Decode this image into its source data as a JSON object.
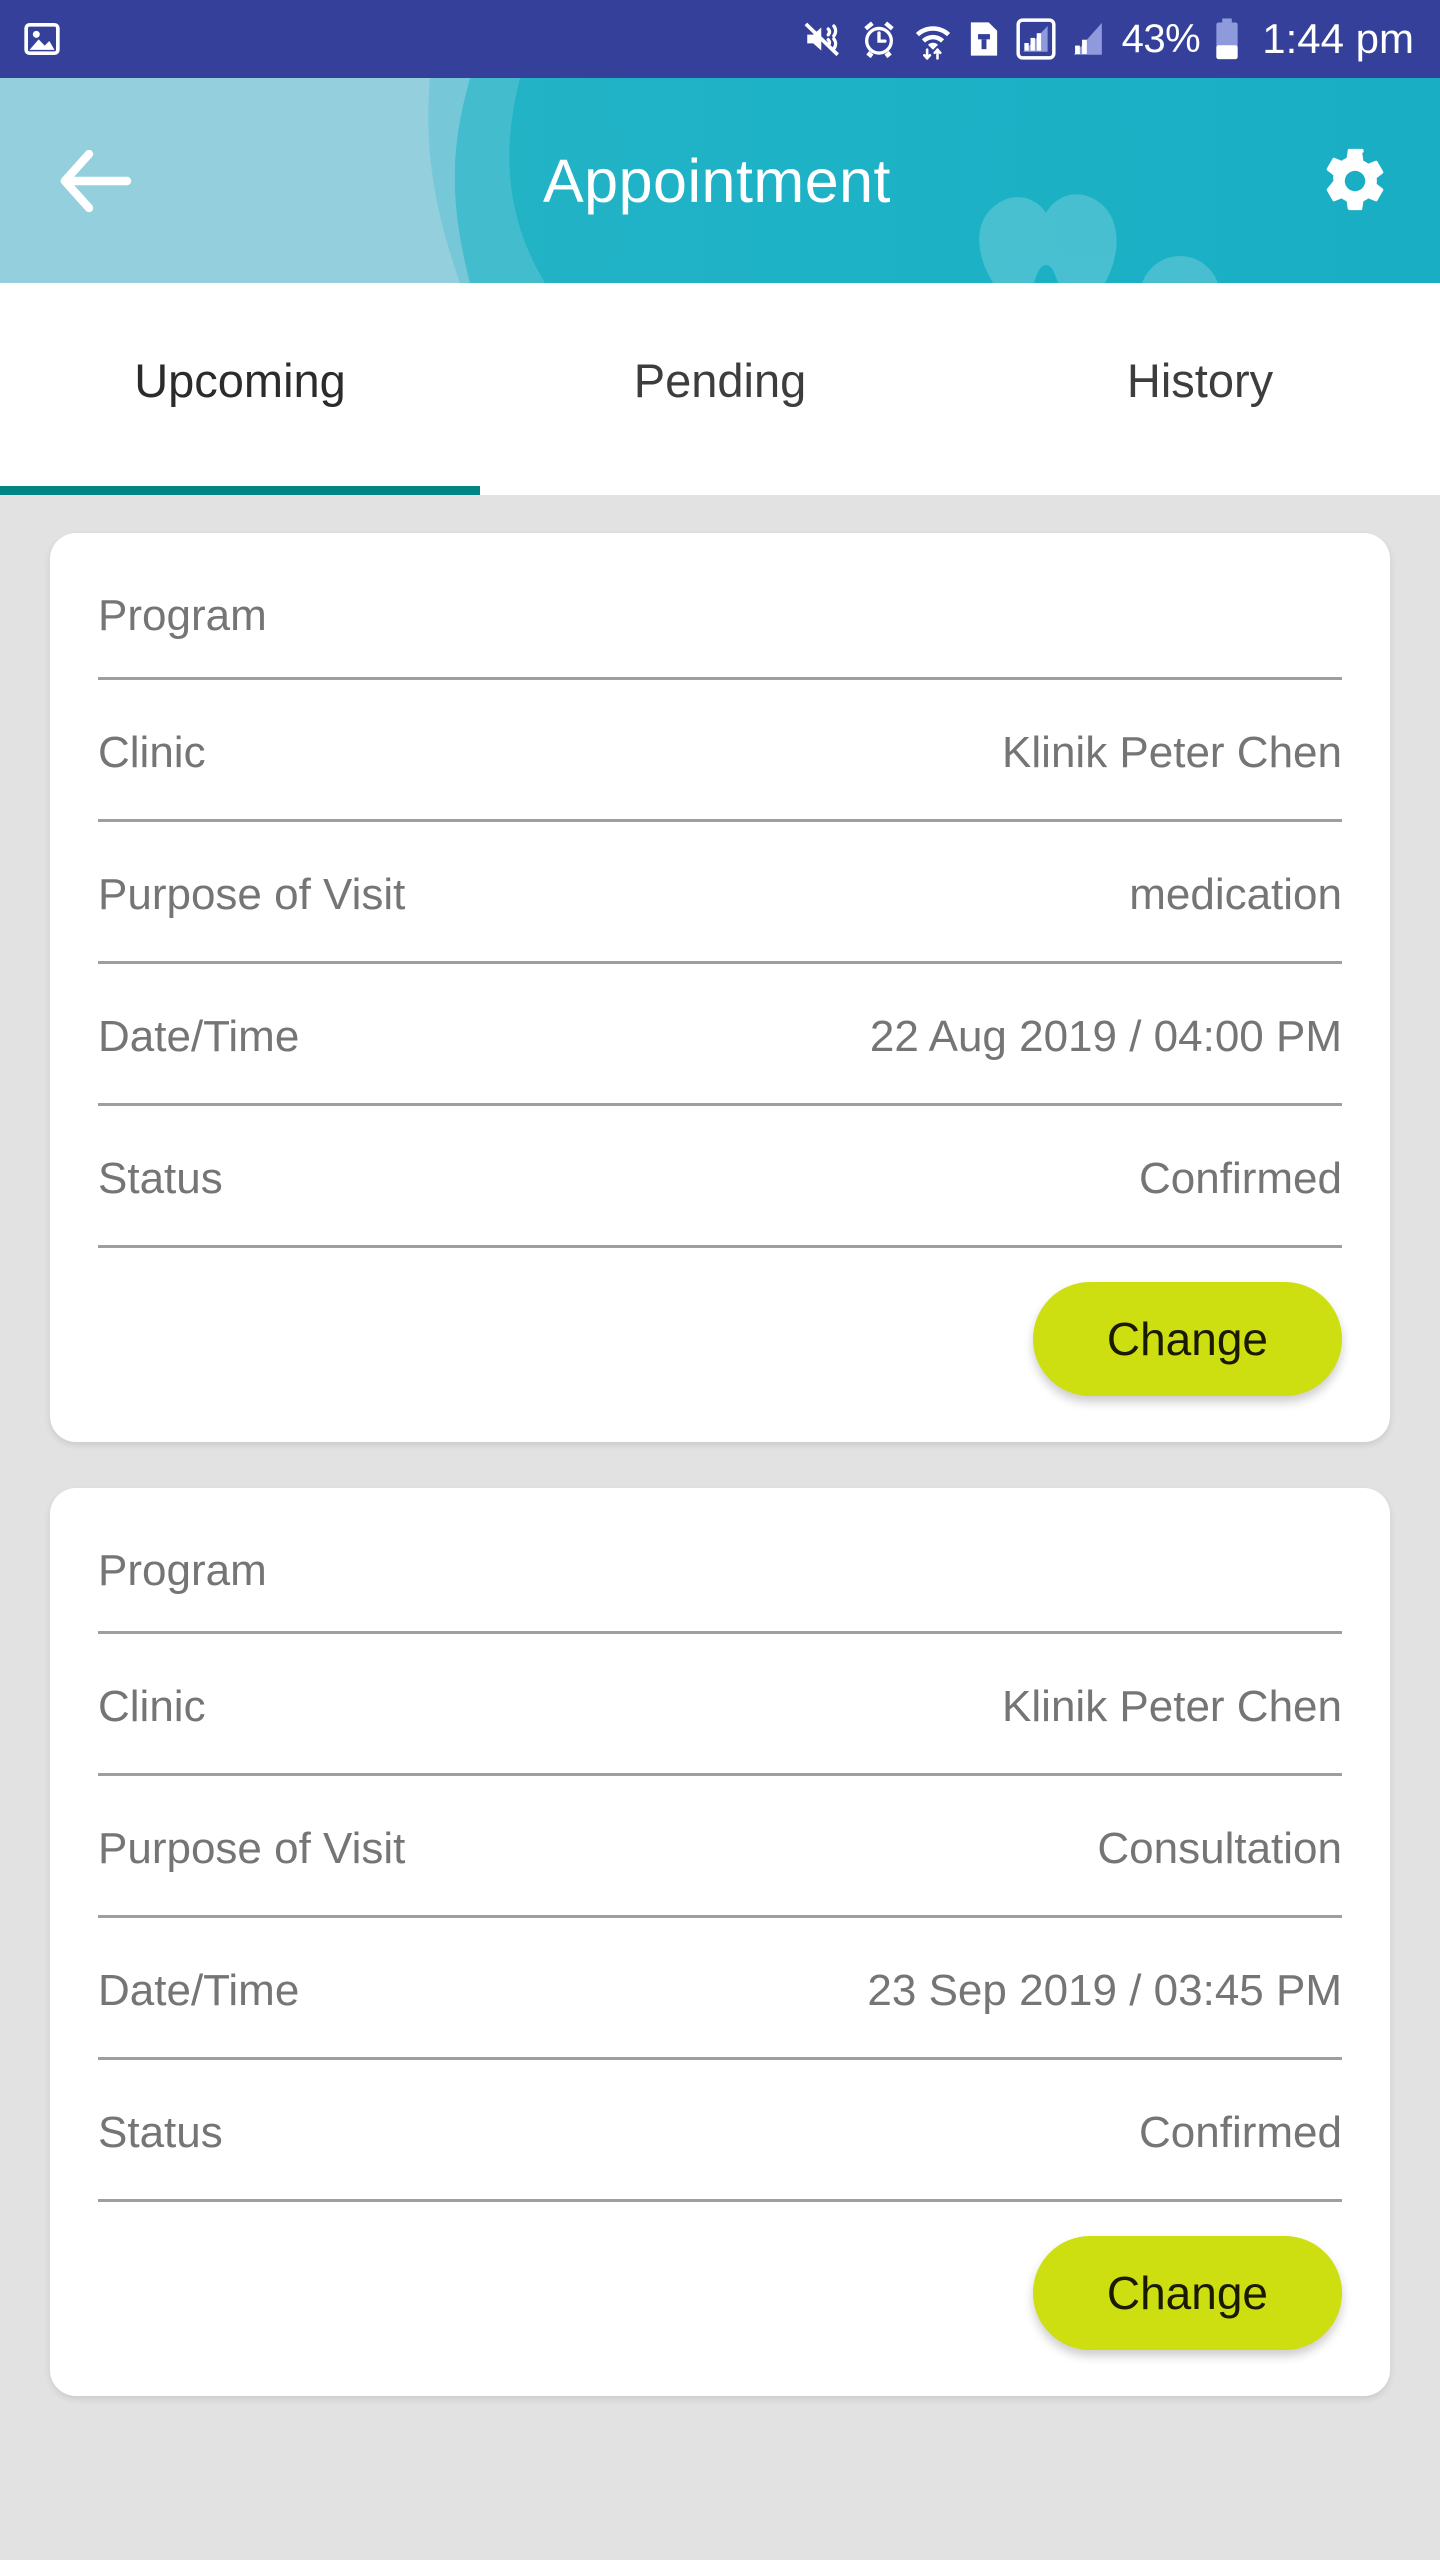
{
  "status_bar": {
    "background_color": "#35409a",
    "left_icons": [
      "image-icon"
    ],
    "right_icons": [
      "vibrate-mute-icon",
      "alarm-icon",
      "wifi-icon",
      "sim-card-icon",
      "signal-bars-1-icon",
      "signal-bars-2-icon"
    ],
    "battery_percent": "43%",
    "battery_icon": "battery-icon",
    "time": "1:44 pm"
  },
  "header": {
    "title": "Appointment",
    "back_icon": "back-arrow-icon",
    "settings_icon": "gear-icon",
    "color_left": "#93cfdd",
    "color_right": "#1fb3c6"
  },
  "tabs": {
    "active_index": 0,
    "underline_color": "#008584",
    "items": [
      {
        "label": "Upcoming"
      },
      {
        "label": "Pending"
      },
      {
        "label": "History"
      }
    ]
  },
  "appointments": [
    {
      "rows": [
        {
          "label": "Program",
          "value": ""
        },
        {
          "label": "Clinic",
          "value": "Klinik Peter Chen"
        },
        {
          "label": "Purpose of Visit",
          "value": "medication"
        },
        {
          "label": "Date/Time",
          "value": "22 Aug 2019 / 04:00 PM"
        },
        {
          "label": "Status",
          "value": "Confirmed"
        }
      ],
      "action_label": "Change"
    },
    {
      "rows": [
        {
          "label": "Program",
          "value": ""
        },
        {
          "label": "Clinic",
          "value": "Klinik Peter Chen"
        },
        {
          "label": "Purpose of Visit",
          "value": "Consultation"
        },
        {
          "label": "Date/Time",
          "value": "23 Sep 2019 / 03:45 PM"
        },
        {
          "label": "Status",
          "value": "Confirmed"
        }
      ],
      "action_label": "Change"
    }
  ],
  "theme": {
    "page_background": "#e2e2e2",
    "card_background": "#ffffff",
    "accent_button": "#cdde11",
    "label_text": "#757575",
    "divider": "#9e9e9e"
  }
}
